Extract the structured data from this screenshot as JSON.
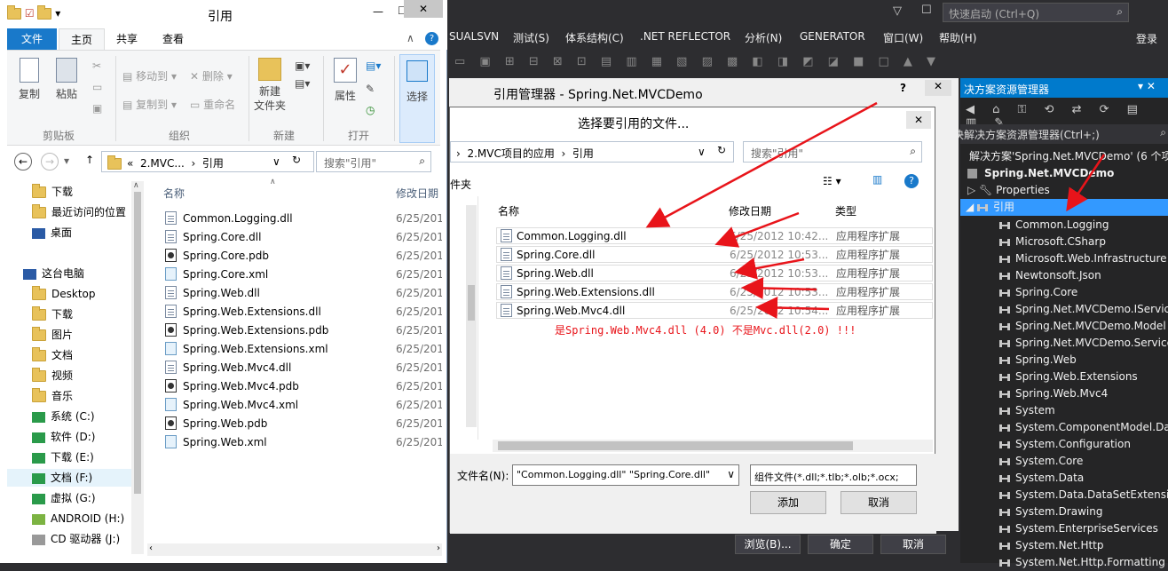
{
  "explorer": {
    "title": "引用",
    "tabs": [
      "文件",
      "主页",
      "共享",
      "查看"
    ],
    "ribbon": {
      "copy": "复制",
      "paste": "粘贴",
      "move_to": "移动到",
      "copy_to": "复制到",
      "delete": "删除",
      "rename": "重命名",
      "new_folder": "新建\n文件夹",
      "properties": "属性",
      "select": "选择",
      "groups": [
        "剪贴板",
        "组织",
        "新建",
        "打开"
      ]
    },
    "address": {
      "prefix": "«",
      "path1": "2.MVC...",
      "path2": "引用"
    },
    "search_placeholder": "搜索\"引用\"",
    "nav_items": [
      "下载",
      "最近访问的位置",
      "桌面",
      "这台电脑",
      "Desktop",
      "下载",
      "图片",
      "文档",
      "视频",
      "音乐",
      "系统 (C:)",
      "软件 (D:)",
      "下载 (E:)",
      "文档 (F:)",
      "虚拟 (G:)",
      "ANDROID (H:)",
      "CD 驱动器 (J:)"
    ],
    "columns": {
      "name": "名称",
      "date": "修改日期"
    },
    "files": [
      {
        "name": "Common.Logging.dll",
        "date": "6/25/201",
        "icon": "doc"
      },
      {
        "name": "Spring.Core.dll",
        "date": "6/25/201",
        "icon": "doc"
      },
      {
        "name": "Spring.Core.pdb",
        "date": "6/25/201",
        "icon": "pdb"
      },
      {
        "name": "Spring.Core.xml",
        "date": "6/25/201",
        "icon": "xml"
      },
      {
        "name": "Spring.Web.dll",
        "date": "6/25/201",
        "icon": "doc"
      },
      {
        "name": "Spring.Web.Extensions.dll",
        "date": "6/25/201",
        "icon": "doc"
      },
      {
        "name": "Spring.Web.Extensions.pdb",
        "date": "6/25/201",
        "icon": "pdb"
      },
      {
        "name": "Spring.Web.Extensions.xml",
        "date": "6/25/201",
        "icon": "xml"
      },
      {
        "name": "Spring.Web.Mvc4.dll",
        "date": "6/25/201",
        "icon": "doc"
      },
      {
        "name": "Spring.Web.Mvc4.pdb",
        "date": "6/25/201",
        "icon": "pdb"
      },
      {
        "name": "Spring.Web.Mvc4.xml",
        "date": "6/25/201",
        "icon": "xml"
      },
      {
        "name": "Spring.Web.pdb",
        "date": "6/25/201",
        "icon": "pdb"
      },
      {
        "name": "Spring.Web.xml",
        "date": "6/25/201",
        "icon": "xml"
      }
    ]
  },
  "vs": {
    "menu": [
      "SUALSVN",
      "测试(S)",
      "体系结构(C)",
      ".NET REFLECTOR",
      "分析(N)",
      "GENERATOR",
      "窗口(W)",
      "帮助(H)"
    ],
    "quick_launch": "快速启动 (Ctrl+Q)",
    "login": "登录",
    "solution_explorer": {
      "title": "决方案资源管理器",
      "search": "决解决方案资源管理器(Ctrl+;)",
      "solution": "解决方案'Spring.Net.MVCDemo' (6 个项",
      "project": "Spring.Net.MVCDemo",
      "properties": "Properties",
      "references_label": "引用",
      "references": [
        "Common.Logging",
        "Microsoft.CSharp",
        "Microsoft.Web.Infrastructure",
        "Newtonsoft.Json",
        "Spring.Core",
        "Spring.Net.MVCDemo.IServic",
        "Spring.Net.MVCDemo.Model",
        "Spring.Net.MVCDemo.Service",
        "Spring.Web",
        "Spring.Web.Extensions",
        "Spring.Web.Mvc4",
        "System",
        "System.ComponentModel.Dat",
        "System.Configuration",
        "System.Core",
        "System.Data",
        "System.Data.DataSetExtension",
        "System.Drawing",
        "System.EnterpriseServices",
        "System.Net.Http",
        "System.Net.Http.Formatting"
      ]
    }
  },
  "ref_manager": {
    "title": "引用管理器 - Spring.Net.MVCDemo",
    "help": "?",
    "browse": "浏览(B)...",
    "ok": "确定",
    "cancel": "取消"
  },
  "file_dialog": {
    "title": "选择要引用的文件...",
    "breadcrumb": [
      "2.MVC项目的应用",
      "引用"
    ],
    "search_placeholder": "搜索\"引用\"",
    "left_label": "件夹",
    "columns": {
      "name": "名称",
      "date": "修改日期",
      "type": "类型"
    },
    "files": [
      {
        "name": "Common.Logging.dll",
        "date": "6/25/2012 10:42...",
        "type": "应用程序扩展"
      },
      {
        "name": "Spring.Core.dll",
        "date": "6/25/2012 10:53...",
        "type": "应用程序扩展"
      },
      {
        "name": "Spring.Web.dll",
        "date": "6/25/2012 10:53...",
        "type": "应用程序扩展"
      },
      {
        "name": "Spring.Web.Extensions.dll",
        "date": "6/25/2012 10:53...",
        "type": "应用程序扩展"
      },
      {
        "name": "Spring.Web.Mvc4.dll",
        "date": "6/25/2012 10:54...",
        "type": "应用程序扩展"
      }
    ],
    "annotation": "是Spring.Web.Mvc4.dll (4.0)   不是Mvc.dll(2.0) !!!",
    "filename_label": "文件名(N):",
    "filename_value": "\"Common.Logging.dll\" \"Spring.Core.dll\"",
    "filter_value": "组件文件(*.dll;*.tlb;*.olb;*.ocx;",
    "add": "添加",
    "cancel": "取消"
  },
  "colors": {
    "accent": "#1979ca",
    "vs_bg": "#2d2d30",
    "arrow": "#e8141a"
  }
}
